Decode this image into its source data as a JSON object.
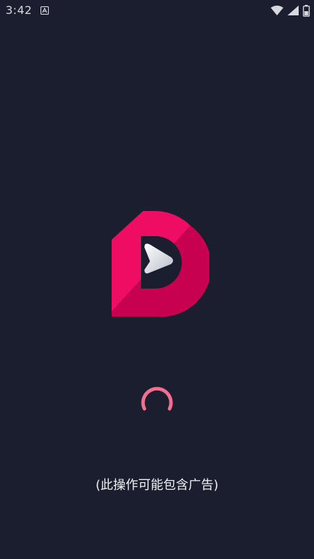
{
  "status_bar": {
    "time": "3:42",
    "icons": [
      "notification-icon",
      "wifi-icon",
      "signal-icon",
      "battery-icon"
    ]
  },
  "splash": {
    "logo": "app-logo-d-play",
    "loading": true,
    "note": "(此操作可能包含广告)"
  },
  "colors": {
    "background": "#1b1e2e",
    "brand_pink": "#ee0d62",
    "brand_pink_dark": "#c7004f",
    "spinner": "#f26f8f"
  }
}
